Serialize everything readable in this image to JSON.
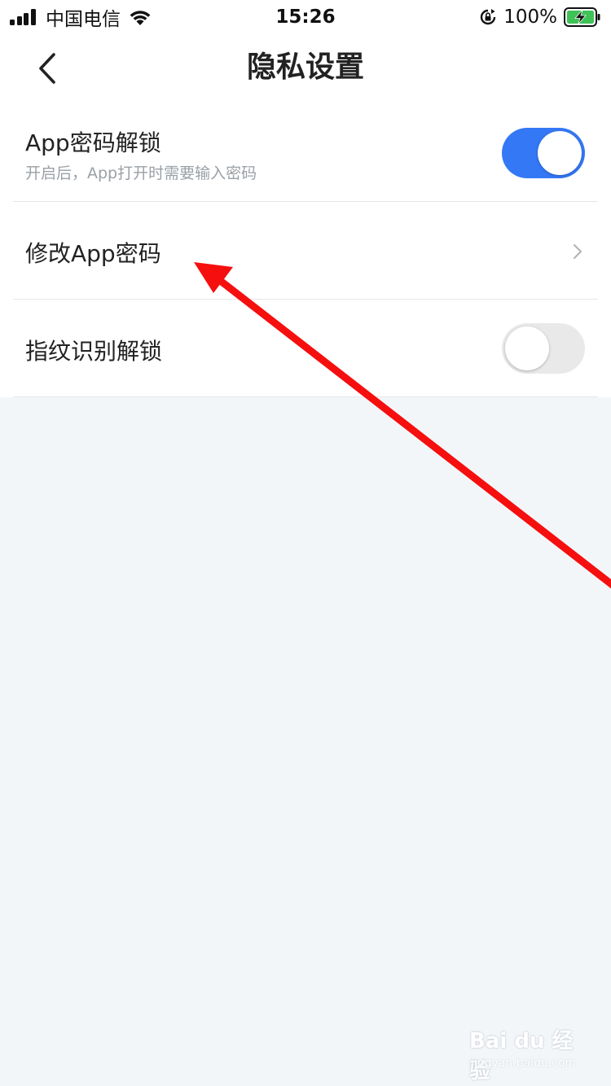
{
  "status_bar": {
    "carrier": "中国电信",
    "time": "15:26",
    "battery_percent": "100%",
    "icons": [
      "signal-icon",
      "wifi-icon",
      "orientation-lock-icon",
      "battery-charging-icon"
    ]
  },
  "nav": {
    "title": "隐私设置",
    "back_icon": "chevron-left-icon"
  },
  "settings": {
    "app_lock": {
      "title": "App密码解锁",
      "subtitle": "开启后，App打开时需要输入密码",
      "enabled": true
    },
    "change_password": {
      "title": "修改App密码",
      "icon": "chevron-right-icon"
    },
    "fingerprint": {
      "title": "指纹识别解锁",
      "enabled": false
    }
  },
  "colors": {
    "toggle_on": "#3478f6",
    "toggle_off": "#e9e9ea",
    "page_background": "#f3f6f9",
    "annotation_arrow": "#f50f0f"
  },
  "watermark": {
    "main": "Bai du 经验",
    "sub": "jingyan.baidu.com"
  }
}
